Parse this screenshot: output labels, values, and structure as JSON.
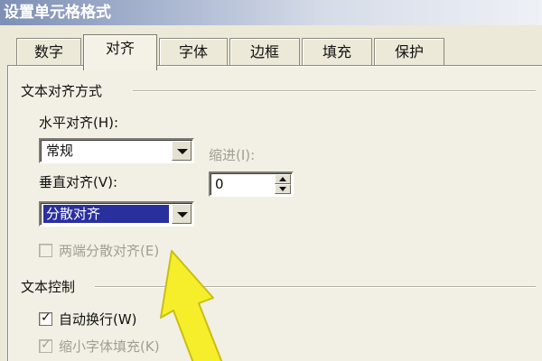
{
  "window": {
    "title": "设置单元格格式"
  },
  "tabs": [
    {
      "label": "数字"
    },
    {
      "label": "对齐"
    },
    {
      "label": "字体"
    },
    {
      "label": "边框"
    },
    {
      "label": "填充"
    },
    {
      "label": "保护"
    }
  ],
  "active_tab": "对齐",
  "alignment": {
    "group_title": "文本对齐方式",
    "horizontal_label": "水平对齐(H):",
    "horizontal_value": "常规",
    "indent_label": "缩进(I):",
    "indent_value": "0",
    "vertical_label": "垂直对齐(V):",
    "vertical_value": "分散对齐",
    "justify_distributed_label": "两端分散对齐(E)",
    "justify_distributed_checked": false
  },
  "text_control": {
    "group_title": "文本控制",
    "wrap_text_label": "自动换行(W)",
    "wrap_text_checked": true,
    "shrink_to_fit_label": "缩小字体填充(K)",
    "shrink_to_fit_checked": true
  },
  "colors": {
    "selection": "#2a2f9e",
    "dialog_bg": "#ece9d8",
    "annotation_arrow": "#f6ee2a"
  },
  "icons": {
    "dropdown": "chevron-down-icon",
    "spin_up": "spin-up-icon",
    "spin_down": "spin-down-icon",
    "check": "check-icon",
    "annotation": "annotation-arrow-icon"
  }
}
